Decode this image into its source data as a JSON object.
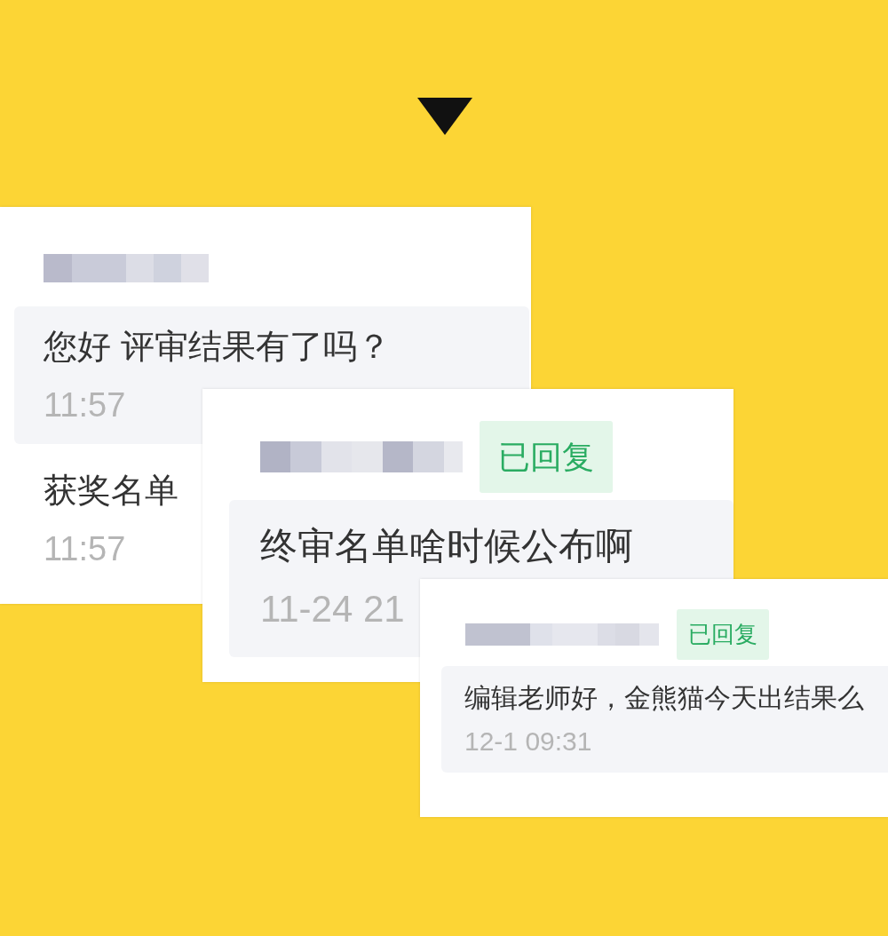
{
  "cards": [
    {
      "messages": [
        {
          "text": "您好 评审结果有了吗？",
          "time": "11:57",
          "selected": true
        },
        {
          "text": "获奖名单",
          "time": "11:57",
          "selected": false
        }
      ]
    },
    {
      "badge": "已回复",
      "messages": [
        {
          "text": "终审名单啥时候公布啊",
          "time": "11-24 21",
          "selected": true
        }
      ]
    },
    {
      "badge": "已回复",
      "messages": [
        {
          "text": "编辑老师好，金熊猫今天出结果么",
          "time": "12-1 09:31",
          "selected": true
        }
      ]
    }
  ]
}
